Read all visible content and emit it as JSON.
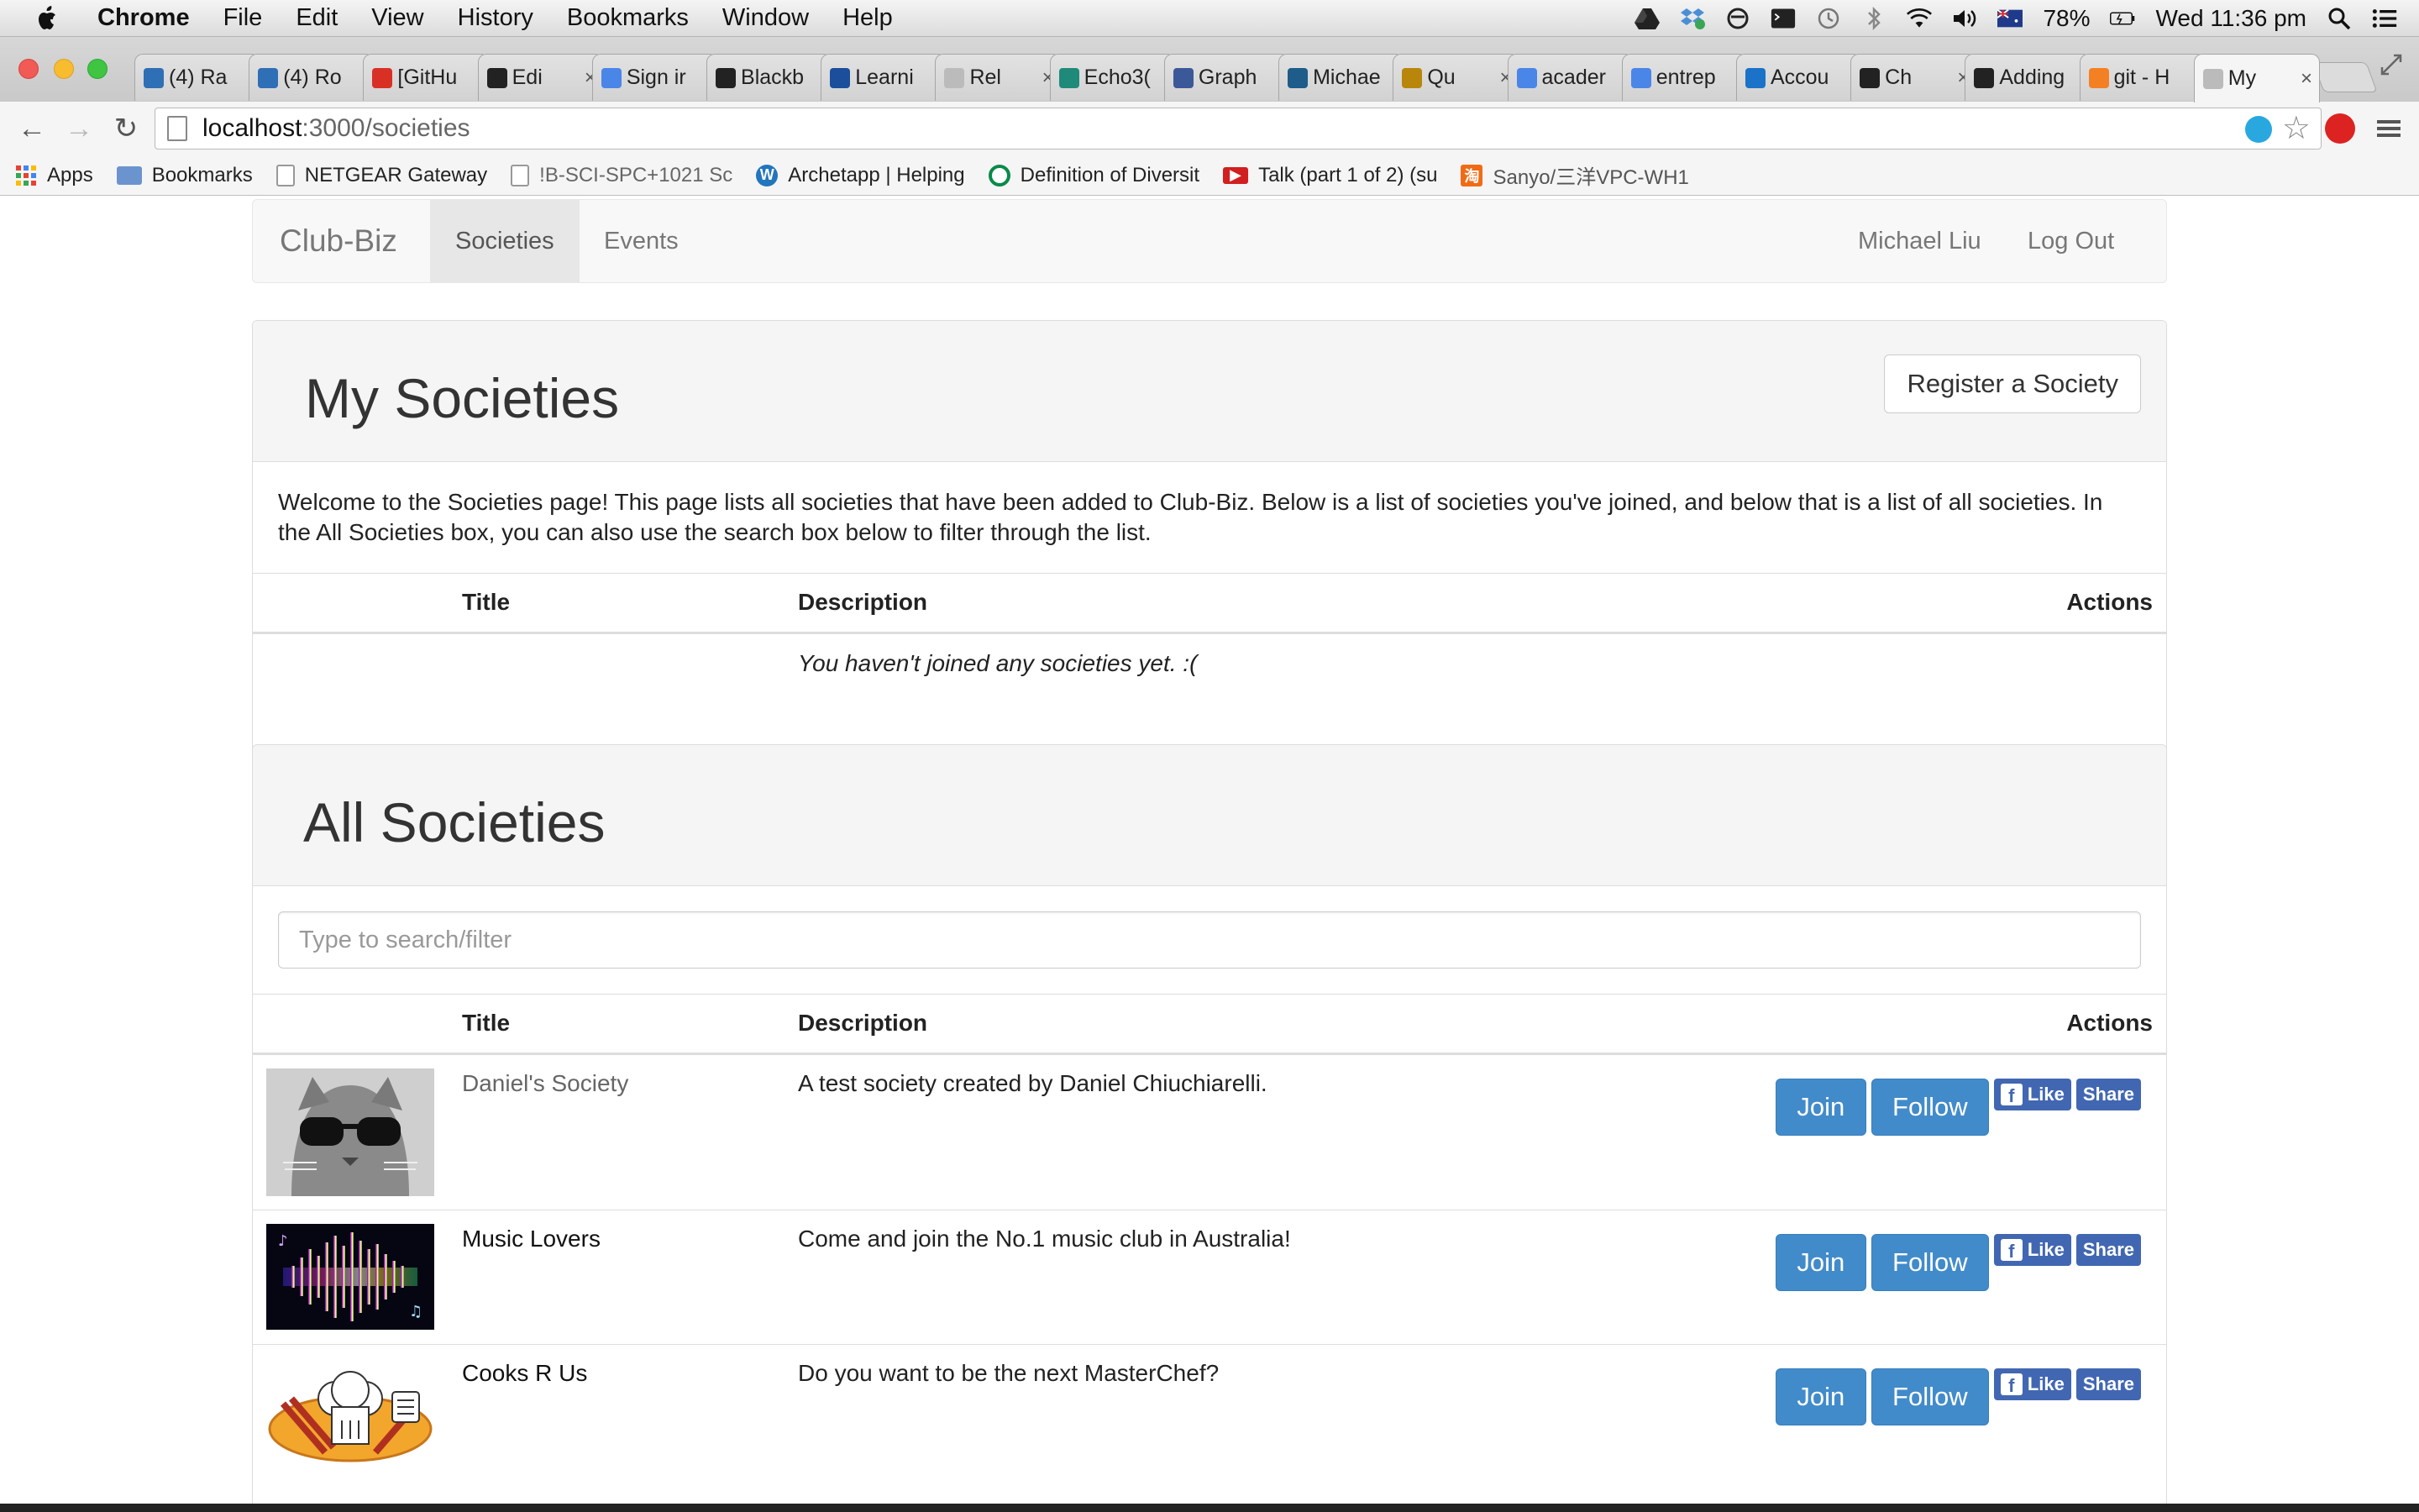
{
  "menubar": {
    "app": "Chrome",
    "items": [
      "File",
      "Edit",
      "View",
      "History",
      "Bookmarks",
      "Window",
      "Help"
    ],
    "battery": "78%",
    "clock": "Wed 11:36 pm"
  },
  "tabs": [
    {
      "label": "(4) Ra",
      "icon": "trello-icon",
      "color": "#2f6fb5"
    },
    {
      "label": "(4) Ro",
      "icon": "trello-icon",
      "color": "#2f6fb5"
    },
    {
      "label": "[GitHu",
      "icon": "gmail-icon",
      "color": "#d93025"
    },
    {
      "label": "Edi",
      "icon": "github-icon",
      "color": "#222222"
    },
    {
      "label": "Sign ir",
      "icon": "google-icon",
      "color": "#4a86e8"
    },
    {
      "label": "Blackb",
      "icon": "blackboard-icon",
      "color": "#222222"
    },
    {
      "label": "Learni",
      "icon": "university-icon",
      "color": "#1b4f9c"
    },
    {
      "label": "Rel",
      "icon": "page-icon",
      "color": "#bbbbbb"
    },
    {
      "label": "Echo3(",
      "icon": "echo-icon",
      "color": "#1f8a7a"
    },
    {
      "label": "Graph",
      "icon": "facebook-icon",
      "color": "#3b5998"
    },
    {
      "label": "Michae",
      "icon": "me-icon",
      "color": "#1e5c8a"
    },
    {
      "label": "Qu",
      "icon": "goodreads-icon",
      "color": "#b8860b"
    },
    {
      "label": "acader",
      "icon": "google-icon",
      "color": "#4a86e8"
    },
    {
      "label": "entrep",
      "icon": "google-icon",
      "color": "#4a86e8"
    },
    {
      "label": "Accou",
      "icon": "telstra-icon",
      "color": "#1a73c8"
    },
    {
      "label": "Ch",
      "icon": "github-icon",
      "color": "#222222"
    },
    {
      "label": "Adding",
      "icon": "github-icon",
      "color": "#222222"
    },
    {
      "label": "git - H",
      "icon": "stackoverflow-icon",
      "color": "#f48024"
    },
    {
      "label": "My",
      "icon": "page-icon",
      "color": "#bbbbbb"
    }
  ],
  "address": {
    "host": "localhost",
    "path": ":3000/societies"
  },
  "bookmarks": [
    {
      "label": "Apps",
      "icon": "apps-icon"
    },
    {
      "label": "Bookmarks",
      "icon": "folder-icon"
    },
    {
      "label": "NETGEAR Gateway",
      "icon": "page-icon"
    },
    {
      "label": "!B-SCI-SPC+1021 Sc",
      "icon": "page-icon"
    },
    {
      "label": "Archetapp | Helping",
      "icon": "wordpress-icon"
    },
    {
      "label": "Definition of Diversit",
      "icon": "definition-icon"
    },
    {
      "label": "Talk (part 1 of 2) (su",
      "icon": "youtube-icon"
    },
    {
      "label": "Sanyo/三洋VPC-WH1",
      "icon": "taobao-icon"
    }
  ],
  "nav": {
    "brand": "Club-Biz",
    "societies": "Societies",
    "events": "Events",
    "user": "Michael Liu",
    "logout": "Log Out"
  },
  "my_societies": {
    "title": "My Societies",
    "register": "Register a Society",
    "intro": "Welcome to the Societies page! This page lists all societies that have been added to Club-Biz. Below is a list of societies you've joined, and below that is a list of all societies. In the All Societies box, you can also use the search box below to filter through the list.",
    "columns": {
      "title": "Title",
      "description": "Description",
      "actions": "Actions"
    },
    "empty": "You haven't joined any societies yet. :("
  },
  "all_societies": {
    "title": "All Societies",
    "search_placeholder": "Type to search/filter",
    "columns": {
      "title": "Title",
      "description": "Description",
      "actions": "Actions"
    },
    "actions": {
      "join": "Join",
      "follow": "Follow",
      "like": "Like",
      "share": "Share"
    },
    "rows": [
      {
        "title": "Daniel's Society",
        "description": "A test society created by Daniel Chiuchiarelli.",
        "image": "cat-sunglasses-image"
      },
      {
        "title": "Music Lovers",
        "description": "Come and join the No.1 music club in Australia!",
        "image": "music-equalizer-image"
      },
      {
        "title": "Cooks R Us",
        "description": "Do you want to be the next MasterChef?",
        "image": "chef-hat-image"
      }
    ]
  }
}
